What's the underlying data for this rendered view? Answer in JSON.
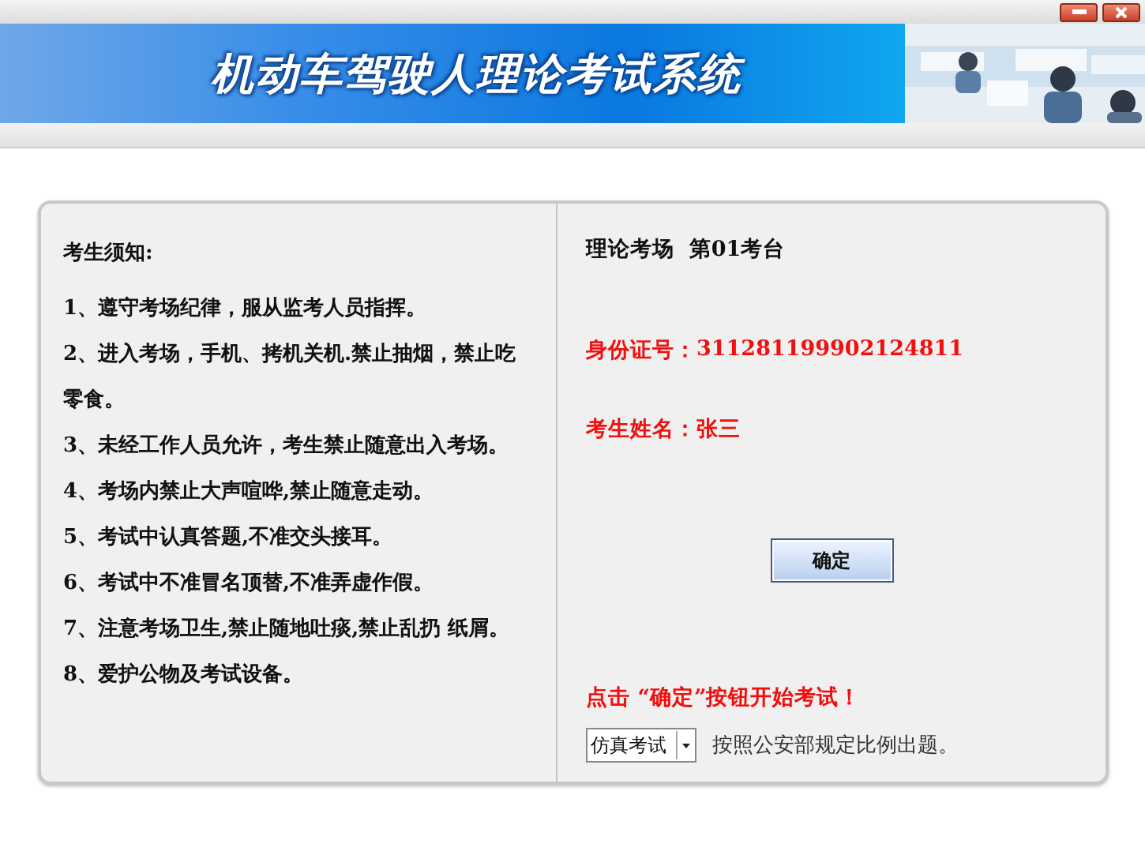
{
  "banner": {
    "title": "机动车驾驶人理论考试系统"
  },
  "notice": {
    "heading": "考生须知:",
    "items": [
      "1、遵守考场纪律，服从监考人员指挥。",
      "2、进入考场，手机、拷机关机.禁止抽烟，禁止吃零食。",
      "3、未经工作人员允许，考生禁止随意出入考场。",
      "4、考场内禁止大声喧哗,禁止随意走动。",
      "5、考试中认真答题,不准交头接耳。",
      "6、考试中不准冒名顶替,不准弄虚作假。",
      "7、注意考场卫生,禁止随地吐痰,禁止乱扔 纸屑。",
      "8、爱护公物及考试设备。"
    ]
  },
  "candidate": {
    "station": "理论考场  第01考台",
    "id_label": "身份证号：",
    "id_value": "311281199902124811",
    "name_label": "考生姓名：",
    "name_value": "张三"
  },
  "confirm_button": "确定",
  "start_hint": "点击 “确定”按钮开始考试！",
  "mode_select": {
    "value": "仿真考试"
  },
  "mode_note": "按照公安部规定比例出题。"
}
